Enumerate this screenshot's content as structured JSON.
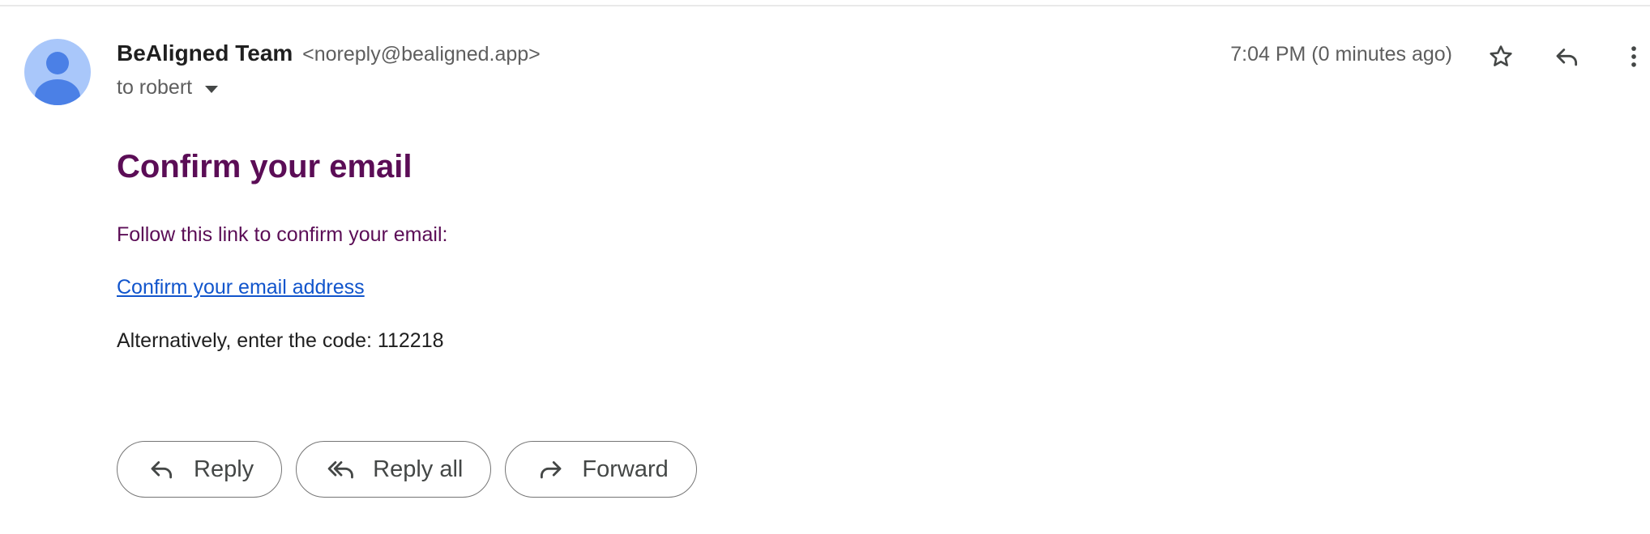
{
  "message": {
    "sender_name": "BeAligned Team",
    "sender_email": "<noreply@bealigned.app>",
    "recipient": "to robert",
    "timestamp": "7:04 PM (0 minutes ago)"
  },
  "header_icons": {
    "star": "star-icon",
    "reply": "reply-icon",
    "more": "more-vert-icon"
  },
  "body": {
    "heading": "Confirm your email",
    "instruction": "Follow this link to confirm your email:",
    "link_text": "Confirm your email address",
    "code_text": "Alternatively, enter the code: 112218"
  },
  "actions": {
    "reply_label": "Reply",
    "reply_all_label": "Reply all",
    "forward_label": "Forward"
  },
  "colors": {
    "heading": "#5b0d56",
    "link": "#1155cc",
    "avatar_bg": "#a9c7fa",
    "avatar_fg": "#4b80e6"
  }
}
